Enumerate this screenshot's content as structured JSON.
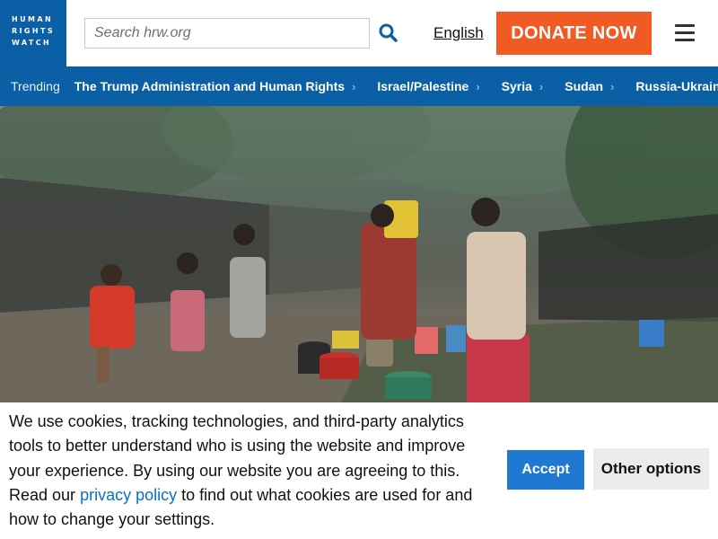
{
  "header": {
    "logo_lines": [
      "HUMAN",
      "RIGHTS",
      "WATCH"
    ],
    "search_placeholder": "Search hrw.org",
    "language": "English",
    "donate_label": "DONATE NOW",
    "brand_color": "#0b5fa5",
    "donate_color": "#f15a22"
  },
  "trending": {
    "label": "Trending",
    "items": [
      {
        "label": "The Trump Administration and Human Rights"
      },
      {
        "label": "Israel/Palestine"
      },
      {
        "label": "Syria"
      },
      {
        "label": "Sudan"
      },
      {
        "label": "Russia-Ukraine War"
      }
    ]
  },
  "cookie": {
    "text_before": "We use cookies, tracking technologies, and third-party analytics tools to better understand who is using the website and improve your experience. By using our website you are agreeing to this. Read our",
    "link_text": "privacy policy",
    "text_after": "to find out what cookies are used for and how to change your settings.",
    "accept_label": "Accept",
    "other_label": "Other options"
  },
  "icons": [
    "search-icon",
    "hamburger-menu-icon",
    "chevron-right-icon"
  ]
}
